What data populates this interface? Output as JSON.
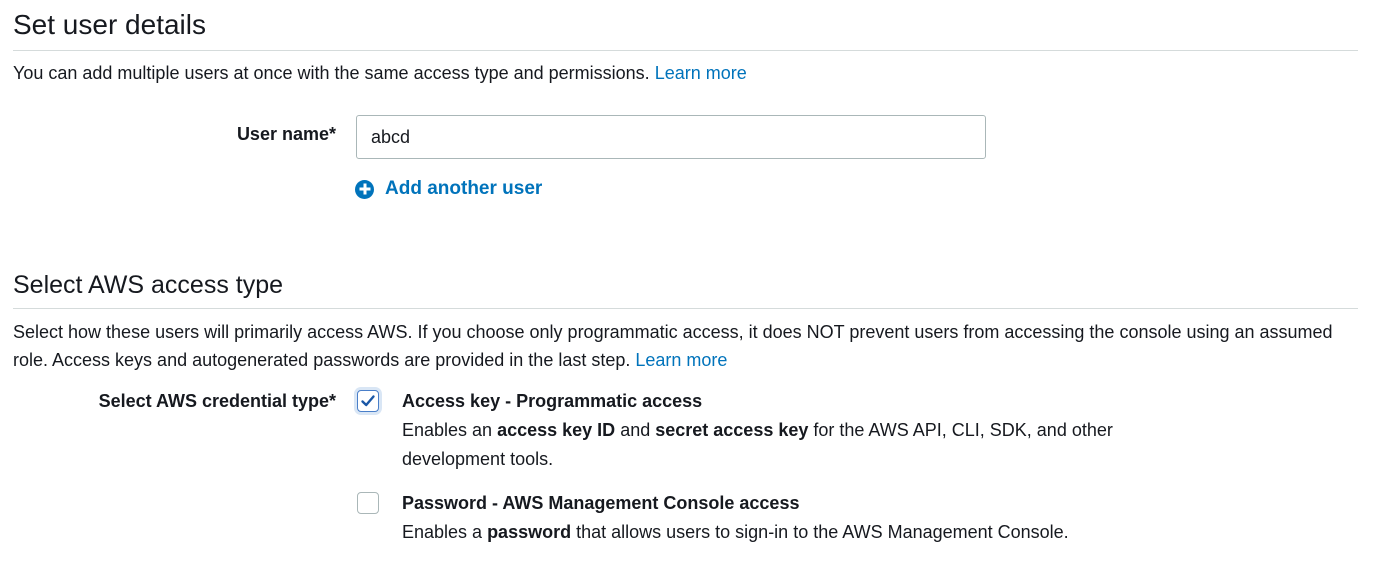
{
  "user_details": {
    "heading": "Set user details",
    "intro": "You can add multiple users at once with the same access type and permissions.",
    "learn_more": "Learn more",
    "user_name_label": "User name*",
    "user_name_value": "abcd",
    "add_another_user": "Add another user"
  },
  "access_type": {
    "heading": "Select AWS access type",
    "intro": "Select how these users will primarily access AWS. If you choose only programmatic access, it does NOT prevent users from accessing the console using an assumed role. Access keys and autogenerated passwords are provided in the last step.",
    "learn_more": "Learn more",
    "credential_label": "Select AWS credential type*",
    "options": [
      {
        "title": "Access key - Programmatic access",
        "checked": true,
        "desc_1": "Enables an ",
        "desc_b1": "access key ID",
        "desc_2": " and ",
        "desc_b2": "secret access key",
        "desc_3": " for the AWS API, CLI, SDK, and other development tools."
      },
      {
        "title": "Password - AWS Management Console access",
        "checked": false,
        "desc_1": "Enables a ",
        "desc_b1": "password",
        "desc_2": " that allows users to sign-in to the AWS Management Console."
      }
    ]
  },
  "colors": {
    "link": "#0073bb",
    "border": "#aab7b8",
    "rule": "#d5dbdb"
  }
}
